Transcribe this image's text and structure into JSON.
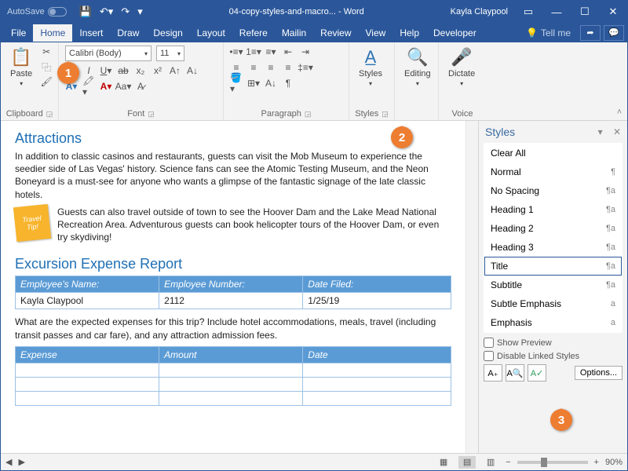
{
  "titlebar": {
    "autosave": "AutoSave",
    "doctitle": "04-copy-styles-and-macro... - Word",
    "user": "Kayla Claypool"
  },
  "tabs": {
    "file": "File",
    "home": "Home",
    "insert": "Insert",
    "draw": "Draw",
    "design": "Design",
    "layout": "Layout",
    "refere": "Refere",
    "mailin": "Mailin",
    "review": "Review",
    "view": "View",
    "help": "Help",
    "developer": "Developer",
    "tellme": "Tell me"
  },
  "ribbon": {
    "clipboard": {
      "paste": "Paste",
      "label": "Clipboard"
    },
    "font": {
      "name": "Calibri (Body)",
      "size": "11",
      "label": "Font"
    },
    "paragraph": {
      "label": "Paragraph"
    },
    "styles": {
      "btn": "Styles",
      "label": "Styles"
    },
    "editing": {
      "btn": "Editing"
    },
    "voice": {
      "btn": "Dictate",
      "label": "Voice"
    }
  },
  "doc": {
    "h1": "Attractions",
    "p1": "In addition to classic casinos and restaurants, guests can visit the Mob Museum to experience the seedier side of Las Vegas' history. Science fans can see the Atomic Testing Museum, and the Neon Boneyard is a must-see for anyone who wants a glimpse of the fantastic signage of the late classic hotels.",
    "tiplabel": "Travel Tip!",
    "tip": "Guests can also travel outside of town to see the Hoover Dam and the Lake Mead National Recreation Area. Adventurous guests can book helicopter tours of the Hoover Dam, or even try skydiving!",
    "h2": "Excursion Expense Report",
    "table1": {
      "headers": [
        "Employee's Name:",
        "Employee Number:",
        "Date Filed:"
      ],
      "row": [
        "Kayla Claypool",
        "2112",
        "1/25/19"
      ]
    },
    "p2": "What are the expected expenses for this trip? Include hotel accommodations, meals, travel (including transit passes and car fare), and any attraction admission fees.",
    "table2": {
      "headers": [
        "Expense",
        "Amount",
        "Date"
      ]
    }
  },
  "pane": {
    "title": "Styles",
    "items": [
      {
        "label": "Clear All",
        "mark": ""
      },
      {
        "label": "Normal",
        "mark": "¶"
      },
      {
        "label": "No Spacing",
        "mark": "¶a"
      },
      {
        "label": "Heading 1",
        "mark": "¶a"
      },
      {
        "label": "Heading 2",
        "mark": "¶a"
      },
      {
        "label": "Heading 3",
        "mark": "¶a"
      },
      {
        "label": "Title",
        "mark": "¶a"
      },
      {
        "label": "Subtitle",
        "mark": "¶a"
      },
      {
        "label": "Subtle Emphasis",
        "mark": "a"
      },
      {
        "label": "Emphasis",
        "mark": "a"
      }
    ],
    "showpreview": "Show Preview",
    "disablelinked": "Disable Linked Styles",
    "options": "Options..."
  },
  "status": {
    "zoom": "90%"
  },
  "badges": {
    "b1": "1",
    "b2": "2",
    "b3": "3"
  }
}
